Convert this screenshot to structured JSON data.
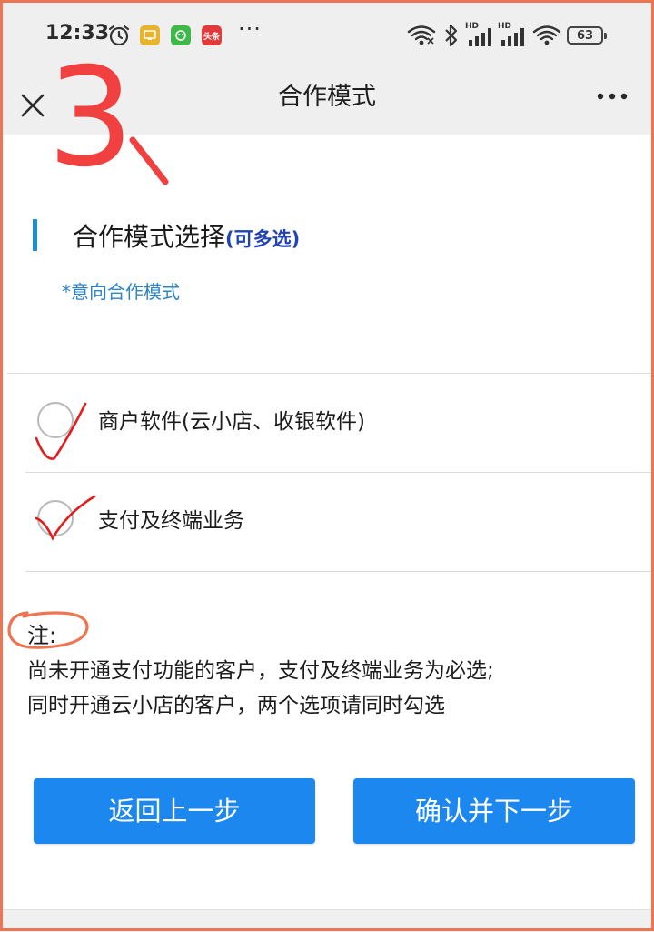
{
  "status_bar": {
    "time": "12:33",
    "more": "···",
    "hd_label": "HD",
    "battery": "63",
    "icons": [
      "alarm-icon",
      "app-yellow-icon",
      "app-green-icon",
      "toutiao-icon",
      "wifi-icon",
      "bluetooth-icon",
      "signal-icon",
      "wifi-icon"
    ],
    "toutiao_text": "头条"
  },
  "nav": {
    "title": "合作模式",
    "close_icon": "close-icon",
    "more_icon": "more-icon"
  },
  "annotation": {
    "step": "3"
  },
  "section": {
    "title": "合作模式选择",
    "hint": "(可多选)",
    "intent_label": "*意向合作模式"
  },
  "options": [
    {
      "label": "商户软件(云小店、收银软件)"
    },
    {
      "label": "支付及终端业务"
    }
  ],
  "note": {
    "head": "注:",
    "lines": [
      "尚未开通支付功能的客户，支付及终端业务为必选;",
      "同时开通云小店的客户，两个选项请同时勾选"
    ]
  },
  "buttons": {
    "back": "返回上一步",
    "confirm": "确认并下一步"
  },
  "colors": {
    "accent": "#1d87f0",
    "section_bar": "#1a8fd6",
    "annotation_red": "#f04040",
    "annotation_orange": "#ee7552"
  }
}
